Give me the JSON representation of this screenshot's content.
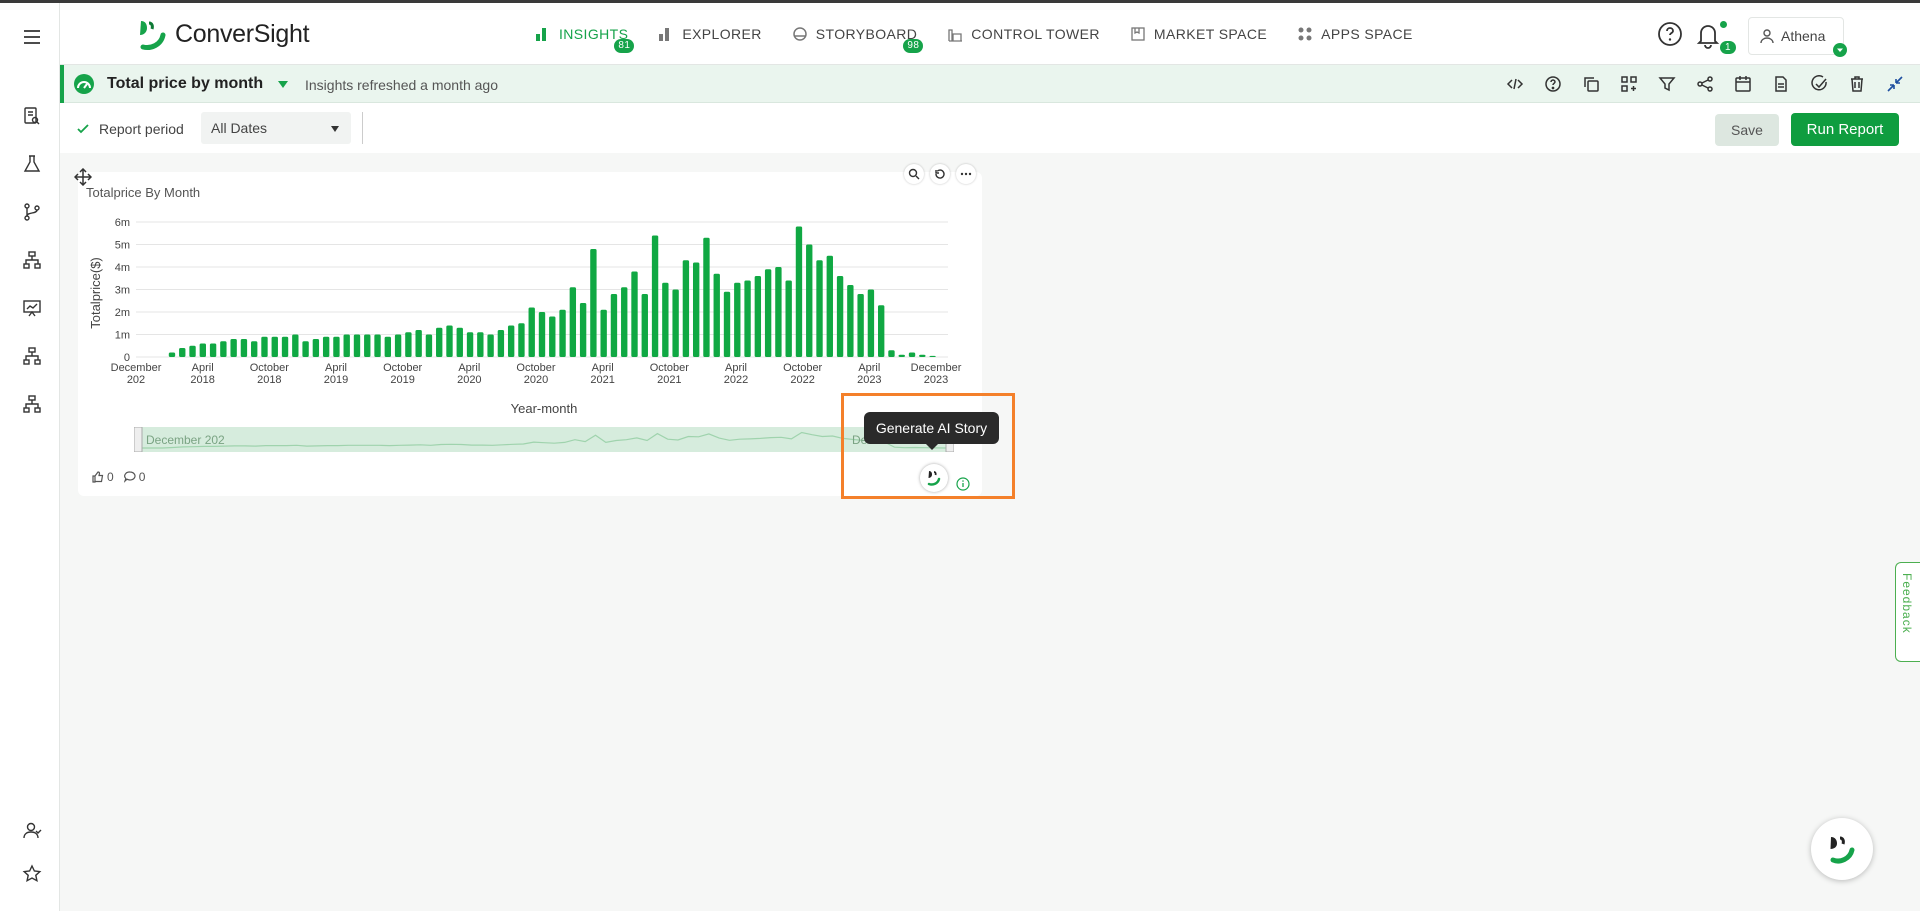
{
  "app": {
    "name": "ConverSight"
  },
  "nav": {
    "items": [
      {
        "label": "INSIGHTS",
        "badge": "81",
        "active": true
      },
      {
        "label": "EXPLORER",
        "badge": ""
      },
      {
        "label": "STORYBOARD",
        "badge": "98"
      },
      {
        "label": "CONTROL TOWER",
        "badge": ""
      },
      {
        "label": "MARKET SPACE",
        "badge": ""
      },
      {
        "label": "APPS SPACE",
        "badge": ""
      }
    ]
  },
  "header": {
    "notifications_count": "1",
    "user_name": "Athena"
  },
  "report": {
    "title": "Total price by month",
    "refresh_text": "Insights refreshed a month ago"
  },
  "filters": {
    "report_period_label": "Report period",
    "period_value": "All Dates",
    "save_label": "Save",
    "run_label": "Run Report"
  },
  "card": {
    "likes": "0",
    "comments": "0",
    "tooltip": "Generate AI Story",
    "scroller_start": "December 202",
    "scroller_end": "De"
  },
  "feedback_label": "Feedback",
  "colors": {
    "brand": "#16a34a",
    "bar": "#10a843",
    "highlight": "#f4802a"
  },
  "chart_data": {
    "type": "bar",
    "title": "Totalprice By Month",
    "xlabel": "Year-month",
    "ylabel": "Totalprice($)",
    "ylim": [
      0,
      6
    ],
    "y_unit": "m",
    "yticks": [
      "0",
      "1m",
      "2m",
      "3m",
      "4m",
      "5m",
      "6m"
    ],
    "x_tick_labels": [
      [
        "December",
        "202"
      ],
      [
        "April",
        "2018"
      ],
      [
        "October",
        "2018"
      ],
      [
        "April",
        "2019"
      ],
      [
        "October",
        "2019"
      ],
      [
        "April",
        "2020"
      ],
      [
        "October",
        "2020"
      ],
      [
        "April",
        "2021"
      ],
      [
        "October",
        "2021"
      ],
      [
        "April",
        "2022"
      ],
      [
        "October",
        "2022"
      ],
      [
        "April",
        "2023"
      ],
      [
        "December",
        "2023"
      ]
    ],
    "values": [
      0,
      0,
      0,
      0.2,
      0.4,
      0.5,
      0.6,
      0.6,
      0.7,
      0.8,
      0.8,
      0.7,
      0.9,
      0.9,
      0.9,
      1.0,
      0.7,
      0.8,
      0.9,
      0.9,
      1.0,
      1.0,
      1.0,
      1.0,
      0.9,
      1.0,
      1.1,
      1.2,
      1.0,
      1.3,
      1.4,
      1.3,
      1.1,
      1.1,
      1.0,
      1.2,
      1.4,
      1.5,
      2.2,
      2.0,
      1.8,
      2.1,
      3.1,
      2.4,
      4.8,
      2.1,
      2.8,
      3.1,
      3.8,
      2.8,
      5.4,
      3.3,
      3.0,
      4.3,
      4.2,
      5.3,
      3.7,
      2.9,
      3.3,
      3.4,
      3.6,
      3.9,
      4.0,
      3.4,
      5.8,
      5.0,
      4.3,
      4.5,
      3.6,
      3.2,
      2.8,
      3.0,
      2.3,
      0.3,
      0.1,
      0.2,
      0.1,
      0.05,
      0.0
    ]
  }
}
